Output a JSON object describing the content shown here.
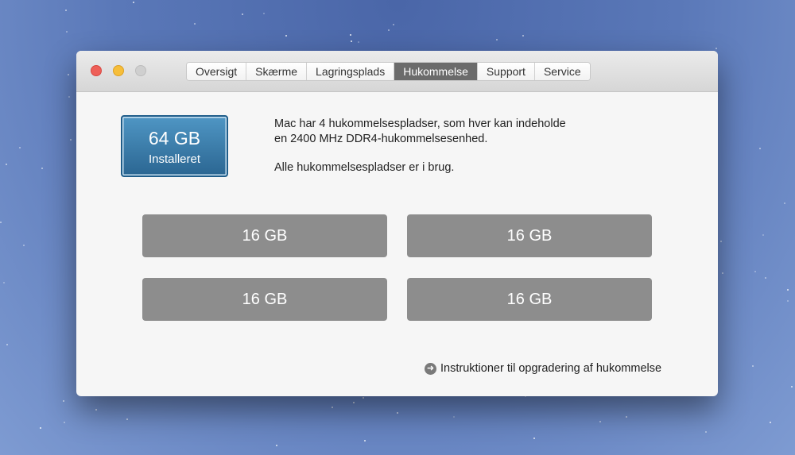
{
  "window": {
    "tabs": [
      {
        "label": "Oversigt",
        "active": false
      },
      {
        "label": "Skærme",
        "active": false
      },
      {
        "label": "Lagringsplads",
        "active": false
      },
      {
        "label": "Hukommelse",
        "active": true
      },
      {
        "label": "Support",
        "active": false
      },
      {
        "label": "Service",
        "active": false
      }
    ]
  },
  "memory": {
    "installed": "64 GB",
    "installed_label": "Installeret",
    "description_line1": "Mac har 4 hukommelsespladser, som hver kan indeholde",
    "description_line2": "en 2400 MHz DDR4-hukommelsesenhed.",
    "status": "Alle hukommelsespladser er i brug.",
    "slots": [
      "16 GB",
      "16 GB",
      "16 GB",
      "16 GB"
    ],
    "upgrade_link": "Instruktioner til opgradering af hukommelse",
    "upgrade_icon": "arrow-right-circle-icon"
  },
  "colors": {
    "close": "#ee5f58",
    "minimize": "#f6be3a",
    "zoom": "#cfcfcf",
    "badge": "#3a7fae",
    "slot": "#8d8d8d",
    "active_tab": "#6b6b6b"
  }
}
